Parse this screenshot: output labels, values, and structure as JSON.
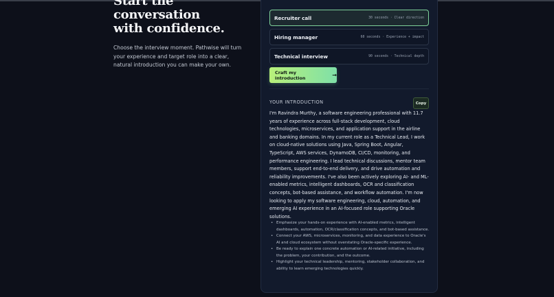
{
  "hero": {
    "title_line1": "Start the",
    "title_line2": "conversation",
    "title_line3": "with confidence.",
    "description": "Choose the interview moment. Pathwise will turn your experience and target role into a clear, natural introduction you can make your own."
  },
  "moments": [
    {
      "name": "Recruiter call",
      "meta": "30 seconds · Clear direction",
      "selected": true
    },
    {
      "name": "Hiring manager",
      "meta": "60 seconds · Experience + impact",
      "selected": false
    },
    {
      "name": "Technical interview",
      "meta": "90 seconds · Technical depth",
      "selected": false
    }
  ],
  "craft_button": {
    "label": "Craft my introduction",
    "arrow": "→"
  },
  "introduction": {
    "section_label": "YOUR INTRODUCTION",
    "copy_label": "Copy",
    "text": "I'm Ravindra Murthy, a software engineering professional with 11.7 years of experience across full-stack development, cloud technologies, microservices, and application support in the airline and banking domains. In my current role as a Technical Lead, I work on cloud-native solutions using Java, Spring Boot, Angular, TypeScript, AWS services, DynamoDB, CI/CD, monitoring, and performance engineering. I lead technical discussions, mentor team members, support end-to-end delivery, and drive automation and reliability improvements. I've also been actively exploring AI- and ML-enabled metrics, intelligent dashboards, OCR and classification concepts, bot-based assistance, and workflow automation. I'm now looking to apply my software engineering, cloud, automation, and emerging AI experience in an AI-focused role supporting Oracle solutions.",
    "tips": [
      "Emphasize your hands-on experience with AI-enabled metrics, intelligent dashboards, automation, OCR/classification concepts, and bot-based assistance.",
      "Connect your AWS, microservices, monitoring, and data experience to Oracle's AI and cloud ecosystem without overstating Oracle-specific experience.",
      "Be ready to explain one concrete automation or AI-related initiative, including the problem, your contribution, and the outcome.",
      "Highlight your technical leadership, mentoring, stakeholder collaboration, and ability to learn emerging technologies quickly."
    ]
  },
  "colors": {
    "accent": "#9be88c",
    "panel": "#121a2c",
    "background": "#0d101a"
  }
}
